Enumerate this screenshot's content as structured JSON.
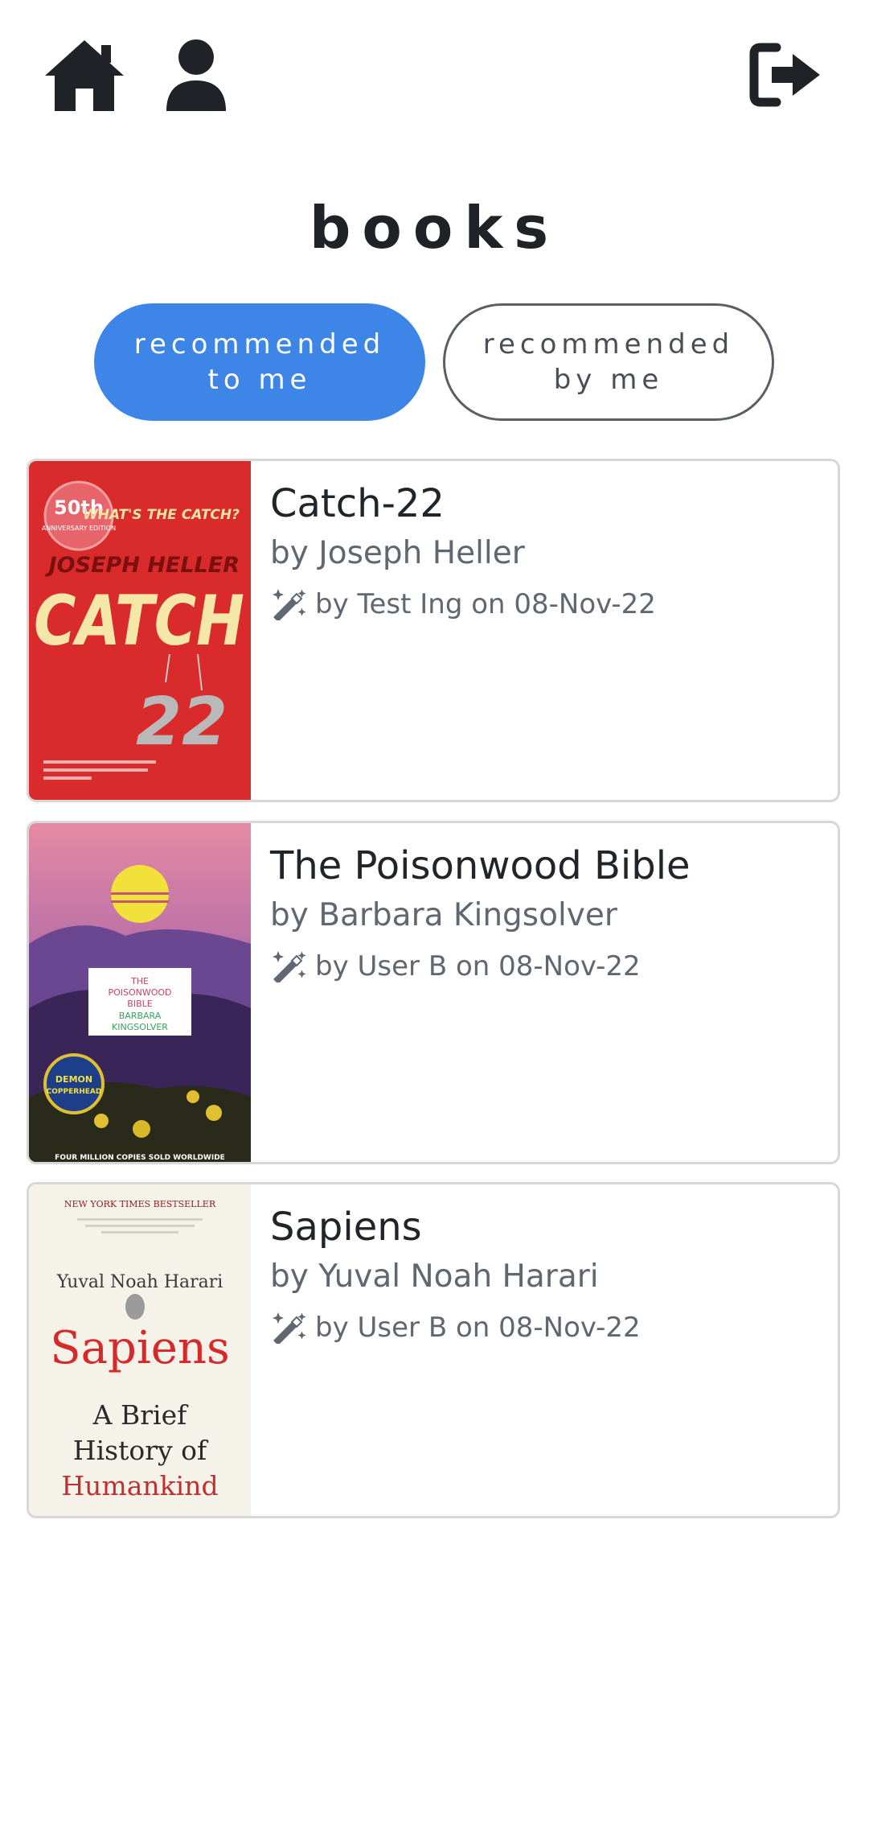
{
  "header": {
    "home_icon": "home-icon",
    "profile_icon": "user-icon",
    "logout_icon": "sign-out-icon"
  },
  "page": {
    "title": "books"
  },
  "tabs": [
    {
      "line1": "recommended",
      "line2": "to me",
      "active": true
    },
    {
      "line1": "recommended",
      "line2": "by me",
      "active": false
    }
  ],
  "books": [
    {
      "title": "Catch-22",
      "author": "by Joseph Heller",
      "recommendation": "by Test Ing on 08-Nov-22",
      "cover": {
        "badge_line1": "50th",
        "badge_line2": "ANNIVERSARY EDITION",
        "tagline": "WHAT'S THE CATCH?",
        "author": "JOSEPH HELLER",
        "word": "CATCH",
        "number": "22"
      }
    },
    {
      "title": "The Poisonwood Bible",
      "author": "by Barbara Kingsolver",
      "recommendation": "by User B on 08-Nov-22",
      "cover": {
        "title_line1": "THE",
        "title_line2": "POISONWOOD",
        "title_line3": "BIBLE",
        "author_line1": "BARBARA",
        "author_line2": "KINGSOLVER",
        "badge_line1": "DEMON",
        "badge_line2": "COPPERHEAD",
        "footer": "FOUR MILLION COPIES SOLD WORLDWIDE"
      }
    },
    {
      "title": "Sapiens",
      "author": "by Yuval Noah Harari",
      "recommendation": "by User B on 08-Nov-22",
      "cover": {
        "header": "NEW YORK TIMES BESTSELLER",
        "author": "Yuval Noah Harari",
        "word": "Sapiens",
        "sub1": "A Brief",
        "sub2": "History of",
        "sub3": "Humankind"
      }
    }
  ],
  "colors": {
    "accent": "#3d85e6",
    "muted_text": "#5f6770",
    "card_border": "#d7d7d7"
  }
}
